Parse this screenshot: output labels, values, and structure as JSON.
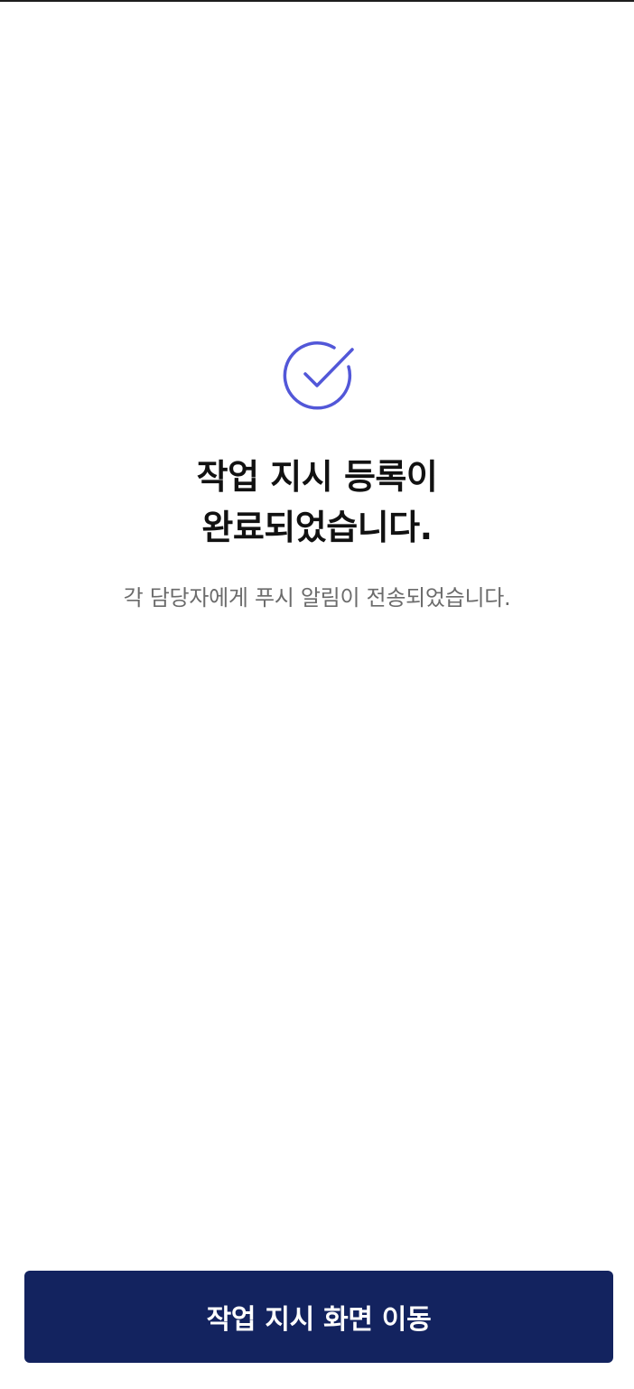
{
  "completion": {
    "icon": "check-circle-icon",
    "accent_color": "#5257d8",
    "title_line_1": "작업 지시 등록이",
    "title_line_2": "완료되었습니다.",
    "subtitle": "각 담당자에게 푸시 알림이 전송되었습니다."
  },
  "footer": {
    "button_label": "작업 지시 화면 이동",
    "button_color": "#13235f"
  }
}
